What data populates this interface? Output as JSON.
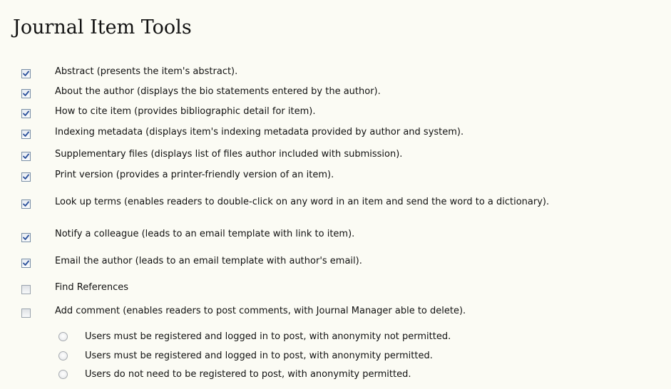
{
  "section": {
    "title": "Journal Item Tools"
  },
  "tools": [
    {
      "label": "Abstract (presents the item's abstract).",
      "checked": true
    },
    {
      "label": "About the author (displays the bio statements entered by the author).",
      "checked": true
    },
    {
      "label": "How to cite item (provides bibliographic detail for item).",
      "checked": true
    },
    {
      "label": "Indexing metadata (displays item's indexing metadata provided by author and system).",
      "checked": true
    },
    {
      "label": "Supplementary files (displays list of files author included with submission).",
      "checked": true
    },
    {
      "label": "Print version (provides a printer-friendly version of an item).",
      "checked": true
    },
    {
      "label": "Look up terms (enables readers to double-click on any word in an item and send the word to a dictionary).",
      "checked": true
    },
    {
      "label": "Notify a colleague (leads to an email template with link to item).",
      "checked": true
    },
    {
      "label": "Email the author (leads to an email template with author's email).",
      "checked": true
    },
    {
      "label": "Find References",
      "checked": false
    },
    {
      "label": "Add comment (enables readers to post comments, with Journal Manager able to delete).",
      "checked": false
    }
  ],
  "comment_options": [
    {
      "label": "Users must be registered and logged in to post, with anonymity not permitted.",
      "selected": false
    },
    {
      "label": "Users must be registered and logged in to post, with anonymity permitted.",
      "selected": false
    },
    {
      "label": "Users do not need to be registered to post, with anonymity permitted.",
      "selected": false
    }
  ],
  "colors": {
    "background": "#fbfbf4",
    "check_mark": "#2a4f9a",
    "checkbox_border": "#7a8fa6"
  }
}
